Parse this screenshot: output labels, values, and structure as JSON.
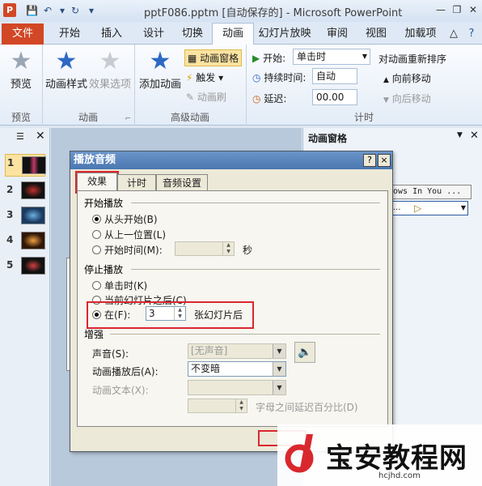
{
  "window": {
    "title": "pptF086.pptm [自动保存的] - Microsoft PowerPoint",
    "app_logo": "P"
  },
  "tabs": [
    "文件",
    "开始",
    "插入",
    "设计",
    "切换",
    "动画",
    "幻灯片放映",
    "审阅",
    "视图",
    "加载项"
  ],
  "ribbon": {
    "preview": {
      "btn": "预览",
      "group": "预览"
    },
    "animation": {
      "style_btn": "动画样式",
      "effect_btn": "效果选项",
      "group": "动画"
    },
    "advanced": {
      "add_btn": "添加动画",
      "pane_btn": "动画窗格",
      "trigger_btn": "触发",
      "brush_btn": "动画刷",
      "group": "高级动画"
    },
    "timing": {
      "start_label": "开始:",
      "start_value": "单击时",
      "duration_label": "持续时间:",
      "duration_value": "自动",
      "delay_label": "延迟:",
      "delay_value": "00.00",
      "reorder_title": "对动画重新排序",
      "forward": "向前移动",
      "backward": "向后移动",
      "group": "计时"
    }
  },
  "slides": [
    "1",
    "2",
    "3",
    "4",
    "5"
  ],
  "anim_pane": {
    "title": "动画窗格",
    "item_text": "ows In You ...",
    "item_text2": "..."
  },
  "dialog": {
    "title": "播放音频",
    "help": "?",
    "close": "×",
    "tabs": [
      "效果",
      "计时",
      "音频设置"
    ],
    "start_section": "开始播放",
    "start_options": [
      "从头开始(B)",
      "从上一位置(L)",
      "开始时间(M):"
    ],
    "start_unit": "秒",
    "stop_section": "停止播放",
    "stop_options": [
      "单击时(K)",
      "当前幻灯片之后(C)",
      "在(F):"
    ],
    "stop_after_value": "3",
    "stop_after_suffix": "张幻灯片后",
    "enhance_section": "增强",
    "sound_label": "声音(S):",
    "sound_value": "[无声音]",
    "after_anim_label": "动画播放后(A):",
    "after_anim_value": "不变暗",
    "anim_text_label": "动画文本(X):",
    "delay_pct_label": "字母之间延迟百分比(D)"
  },
  "watermark": {
    "text": "宝安教程网",
    "url": "hcjhd.com"
  },
  "colors": {
    "file_tab": "#d24726",
    "highlight_red": "#d9272e",
    "dialog_title": "#4a77b1"
  }
}
